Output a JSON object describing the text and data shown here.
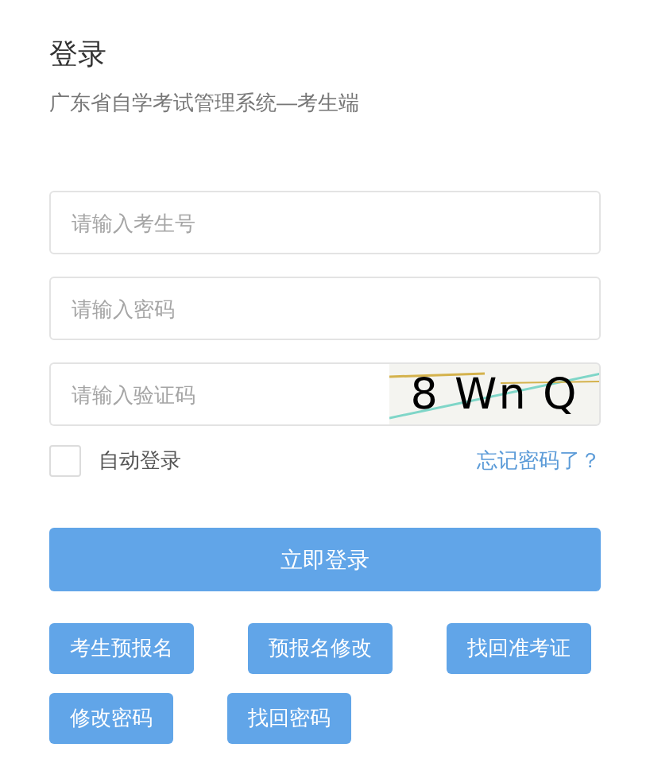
{
  "title": "登录",
  "subtitle": "广东省自学考试管理系统—考生端",
  "fields": [
    {
      "placeholder": "请输入考生号",
      "kind": "text"
    },
    {
      "placeholder": "请输入密码",
      "kind": "password"
    },
    {
      "placeholder": "请输入验证码",
      "kind": "captcha",
      "captcha_text": "8 Wn Q"
    }
  ],
  "auto_login": {
    "label": "自动登录",
    "checked": false
  },
  "forgot_link": "忘记密码了？",
  "login_button": "立即登录",
  "action_buttons": [
    [
      "考生预报名",
      "预报名修改",
      "找回准考证"
    ],
    [
      "修改密码",
      "找回密码"
    ]
  ]
}
